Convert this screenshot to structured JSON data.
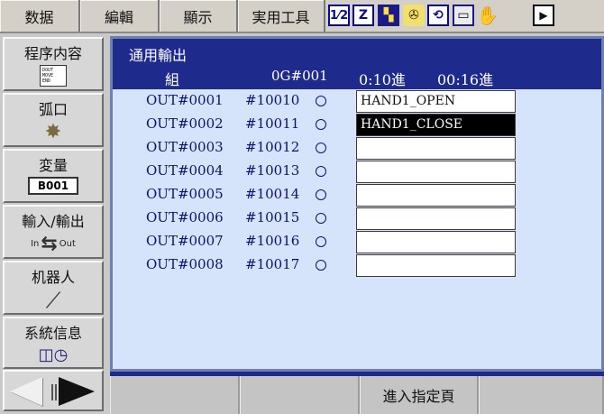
{
  "menubar": {
    "items": [
      "数据",
      "編輯",
      "顯示",
      "実用工具"
    ],
    "status_icons": [
      {
        "name": "robot-axis-icon",
        "glyph": "1⁄2"
      },
      {
        "name": "edit-mode-icon",
        "glyph": "Z"
      },
      {
        "name": "play-mode-icon",
        "glyph": "▚"
      },
      {
        "name": "coordinate-icon",
        "glyph": "✇"
      },
      {
        "name": "cycle-icon",
        "glyph": "⟲"
      },
      {
        "name": "screen-icon",
        "glyph": "▭"
      },
      {
        "name": "hand-icon",
        "glyph": "✋"
      },
      {
        "name": "page-arrow-icon",
        "glyph": "▶"
      }
    ]
  },
  "sidebar": {
    "items": [
      {
        "label": "程序内容",
        "icon": "job-document-icon",
        "icon_text": "DOUT MOVE END"
      },
      {
        "label": "弧口",
        "icon": "arc-welding-icon"
      },
      {
        "label": "変量",
        "icon": "variable-icon",
        "icon_text": "B001"
      },
      {
        "label": "輸入/輸出",
        "icon": "in-out-icon",
        "icon_in": "In",
        "icon_out": "Out"
      },
      {
        "label": "机器人",
        "icon": "robot-arm-icon"
      },
      {
        "label": "系統信息",
        "icon": "system-info-icon"
      }
    ]
  },
  "panel": {
    "title": "通用輸出",
    "header": {
      "group_label": "組",
      "group_value": "0G#001",
      "time1": "0:10進",
      "time2": "00:16進"
    },
    "rows": [
      {
        "out": "OUT#0001",
        "addr": "#10010",
        "name": "HAND1_OPEN",
        "selected": false
      },
      {
        "out": "OUT#0002",
        "addr": "#10011",
        "name": "HAND1_CLOSE",
        "selected": true
      },
      {
        "out": "OUT#0003",
        "addr": "#10012",
        "name": "",
        "selected": false
      },
      {
        "out": "OUT#0004",
        "addr": "#10013",
        "name": "",
        "selected": false
      },
      {
        "out": "OUT#0005",
        "addr": "#10014",
        "name": "",
        "selected": false
      },
      {
        "out": "OUT#0006",
        "addr": "#10015",
        "name": "",
        "selected": false
      },
      {
        "out": "OUT#0007",
        "addr": "#10016",
        "name": "",
        "selected": false
      },
      {
        "out": "OUT#0008",
        "addr": "#10017",
        "name": "",
        "selected": false
      }
    ]
  },
  "function_bar": {
    "items": [
      "",
      "",
      "進入指定頁",
      ""
    ]
  },
  "colors": {
    "title_bg": "#1f2b8c",
    "panel_bg": "#d6e4fb",
    "text_dark_blue": "#101070",
    "selected_bg": "#000000"
  }
}
